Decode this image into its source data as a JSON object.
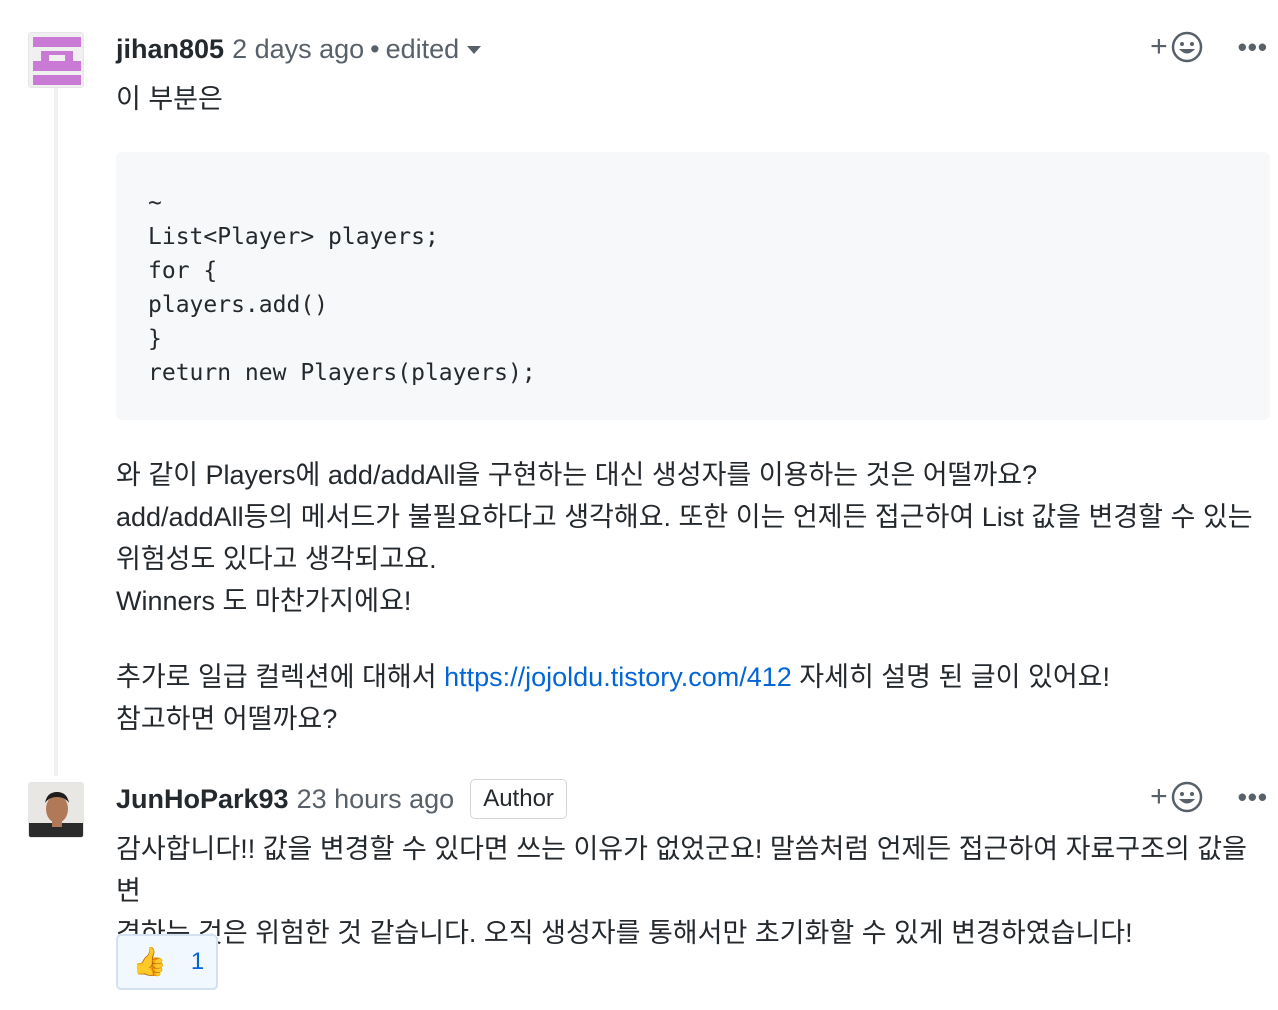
{
  "comment1": {
    "author": "jihan805",
    "time": "2 days ago",
    "dot": "•",
    "edited": "edited",
    "add_reaction_label": "+",
    "more_label": "•••",
    "intro": "이 부분은",
    "code_lines": [
      "~",
      "List<Player> players;",
      "for {",
      "players.add()",
      "}",
      "return new Players(players);"
    ],
    "para1": [
      "와 같이 Players에 add/addAll을 구현하는 대신 생성자를 이용하는 것은 어떨까요?",
      "add/addAll등의 메서드가 불필요하다고 생각해요. 또한 이는 언제든 접근하여 List 값을 변경할 수 있는",
      "위험성도 있다고 생각되고요.",
      "Winners 도 마찬가지에요!"
    ],
    "para2_prefix": "추가로 일급 컬렉션에 대해서 ",
    "para2_link": "https://jojoldu.tistory.com/412",
    "para2_suffix": " 자세히 설명 된 글이 있어요!",
    "para2_line2": "참고하면 어떨까요?"
  },
  "comment2": {
    "author": "JunHoPark93",
    "time": "23 hours ago",
    "badge": "Author",
    "add_reaction_label": "+",
    "more_label": "•••",
    "body_lines": [
      "감사합니다!! 값을 변경할 수 있다면 쓰는 이유가 없었군요! 말씀처럼 언제든 접근하여 자료구조의 값을 변",
      "경하는 것은 위험한 것 같습니다. 오직 생성자를 통해서만 초기화할 수 있게 변경하였습니다!"
    ],
    "reaction": {
      "emoji": "👍",
      "count": "1"
    }
  },
  "colors": {
    "link": "#0366d6",
    "identicon": "#c87ad4",
    "muted": "#586069"
  }
}
